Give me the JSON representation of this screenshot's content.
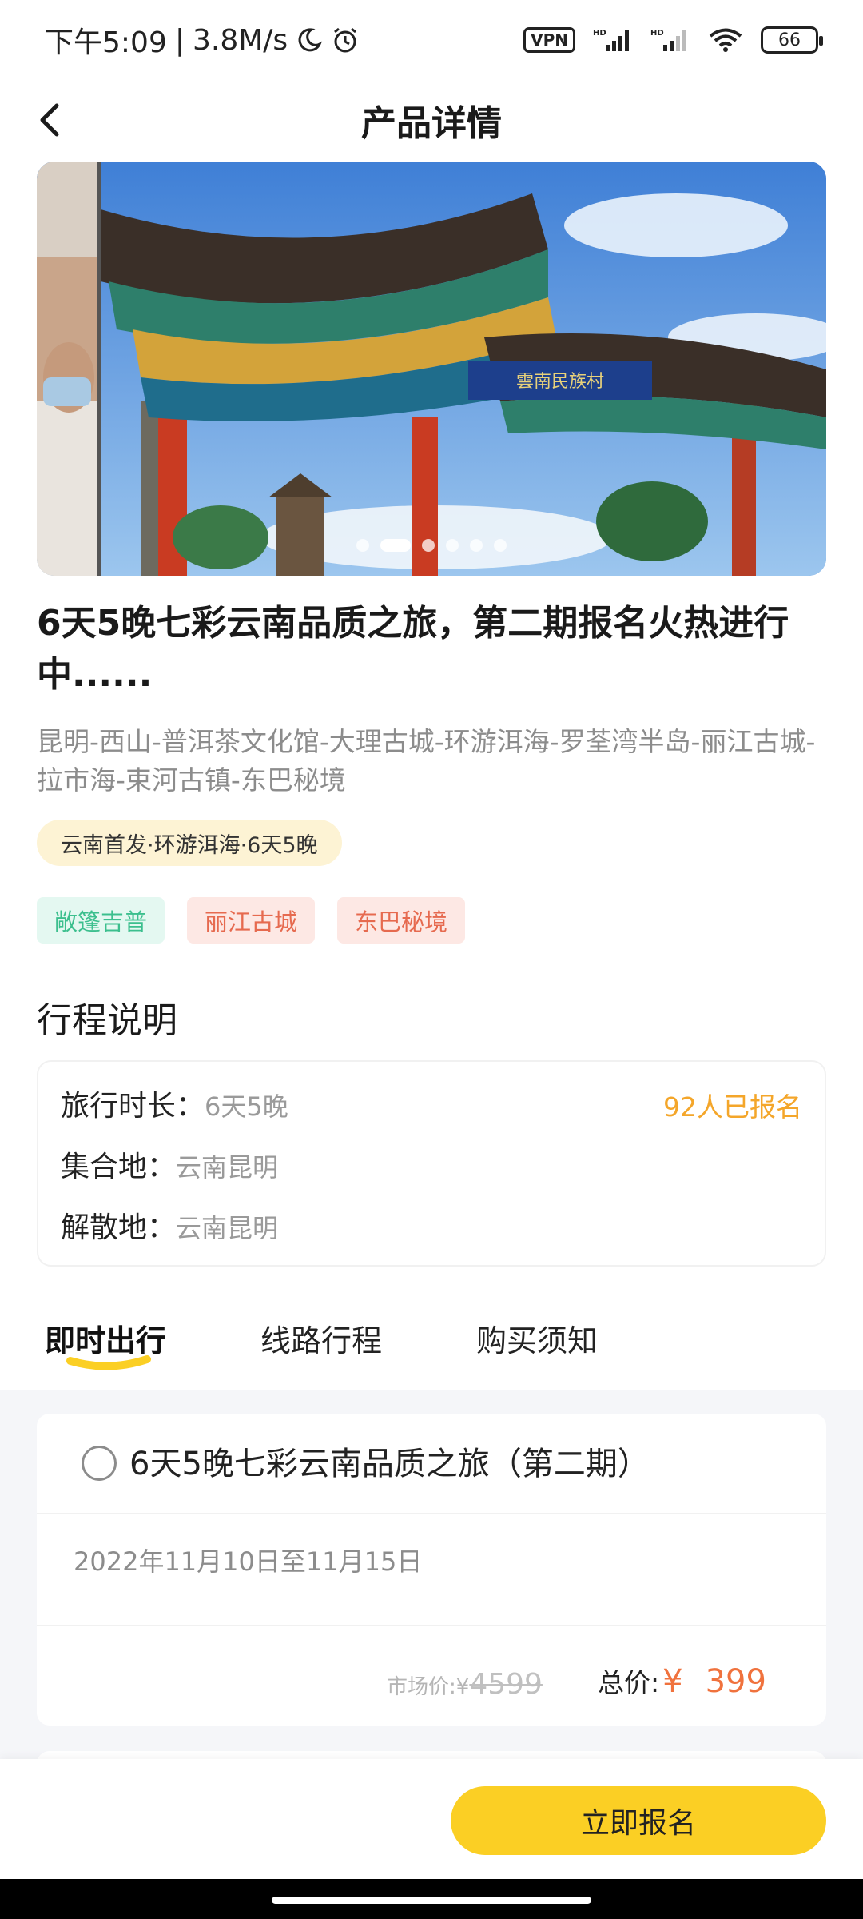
{
  "status_bar": {
    "time": "下午5:09",
    "speed": "3.8M/s",
    "vpn": "VPN",
    "battery": "66"
  },
  "header": {
    "title": "产品详情"
  },
  "banner": {
    "slide_count": 6,
    "active_slide": 2,
    "sign_text": "雲南民族村"
  },
  "product": {
    "title": "6天5晚七彩云南品质之旅，第二期报名火热进行中......",
    "route": "昆明-西山-普洱茶文化馆-大理古城-环游洱海-罗荃湾半岛-丽江古城-拉市海-束河古镇-东巴秘境",
    "tag": "云南首发·环游洱海·6天5晚",
    "chips": [
      "敞篷吉普",
      "丽江古城",
      "东巴秘境"
    ]
  },
  "itinerary": {
    "section_title": "行程说明",
    "duration_label": "旅行时长：",
    "duration_value": "6天5晚",
    "signup_count": "92人已报名",
    "meet_label": "集合地：",
    "meet_value": "云南昆明",
    "dismiss_label": "解散地：",
    "dismiss_value": "云南昆明"
  },
  "tabs": [
    {
      "label": "即时出行",
      "active": true
    },
    {
      "label": "线路行程",
      "active": false
    },
    {
      "label": "购买须知",
      "active": false
    }
  ],
  "trip_option": {
    "name": "6天5晚七彩云南品质之旅（第二期）",
    "date": "2022年11月10日至11月15日",
    "market_label": "市场价:¥",
    "market_price": "4599",
    "total_label": "总价:",
    "currency": "¥",
    "total_price": "399"
  },
  "footer": {
    "signup_button": "立即报名"
  },
  "colors": {
    "accent_yellow": "#fbcf24",
    "price_orange": "#f0723d",
    "signup_orange": "#f4a62a"
  }
}
